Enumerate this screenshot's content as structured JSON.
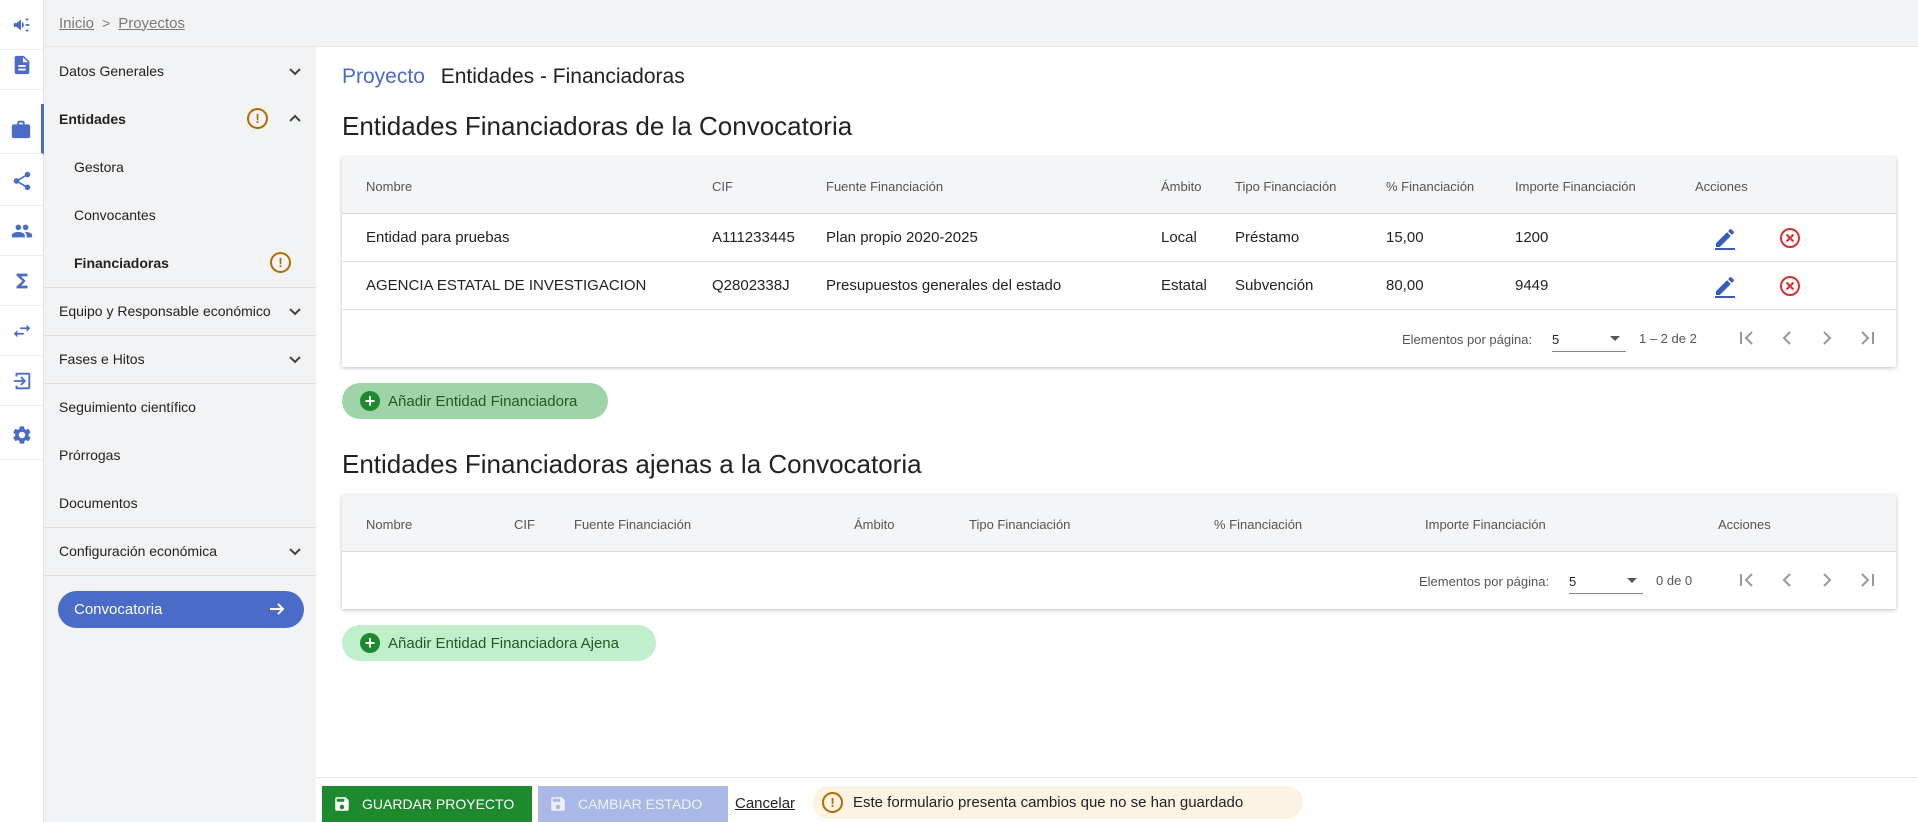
{
  "breadcrumb": {
    "home": "Inicio",
    "separator": ">",
    "current": "Proyectos"
  },
  "rail": [
    "megaphone-icon",
    "document-icon",
    "briefcase-icon",
    "share-icon",
    "people-icon",
    "sigma-icon",
    "swap-icon",
    "logout-icon",
    "settings-icon"
  ],
  "sidebar": {
    "items": [
      {
        "label": "Datos Generales",
        "chevron": "down"
      },
      {
        "label": "Entidades",
        "chevron": "up",
        "warning": "!"
      },
      {
        "label": "Gestora"
      },
      {
        "label": "Convocantes"
      },
      {
        "label": "Financiadoras",
        "warning": "!"
      },
      {
        "label": "Equipo y Responsable económico",
        "chevron": "down"
      },
      {
        "label": "Fases e Hitos",
        "chevron": "down"
      },
      {
        "label": "Seguimiento científico"
      },
      {
        "label": "Prórrogas"
      },
      {
        "label": "Documentos"
      },
      {
        "label": "Configuración económica",
        "chevron": "down"
      }
    ],
    "convocatoria_button": "Convocatoria",
    "accent_color": "#4a6bc7"
  },
  "page": {
    "prefix": "Proyecto",
    "title": "Entidades - Financiadoras"
  },
  "section1": {
    "title": "Entidades Financiadoras de la Convocatoria",
    "columns": [
      "Nombre",
      "CIF",
      "Fuente Financiación",
      "Ámbito",
      "Tipo Financiación",
      "% Financiación",
      "Importe Financiación",
      "Acciones"
    ],
    "rows": [
      [
        "Entidad para pruebas",
        "A111233445",
        "Plan propio 2020-2025",
        "Local",
        "Préstamo",
        "15,00",
        "1200"
      ],
      [
        "AGENCIA ESTATAL DE INVESTIGACION",
        "Q2802338J",
        "Presupuestos generales del estado",
        "Estatal",
        "Subvención",
        "80,00",
        "9449"
      ]
    ],
    "pager": {
      "label": "Elementos por página:",
      "page_size": "5",
      "range": "1 – 2 de 2"
    },
    "add_button": "Añadir Entidad Financiadora",
    "add_button_color": "#9fd4a9"
  },
  "section2": {
    "title": "Entidades Financiadoras ajenas a la Convocatoria",
    "columns": [
      "Nombre",
      "CIF",
      "Fuente Financiación",
      "Ámbito",
      "Tipo Financiación",
      "% Financiación",
      "Importe Financiación",
      "Acciones"
    ],
    "pager": {
      "label": "Elementos por página:",
      "page_size": "5",
      "range": "0 de 0"
    },
    "add_button": "Añadir Entidad Financiadora Ajena",
    "add_button_color": "#c2efcb"
  },
  "footer": {
    "save": "GUARDAR PROYECTO",
    "change_state": "CAMBIAR ESTADO",
    "cancel": "Cancelar",
    "unsaved_message": "Este formulario presenta cambios que no se han guardado",
    "save_color": "#1c8a2d",
    "warning_color": "#b36b00"
  },
  "colors": {
    "edit_icon": "#3b5bbf",
    "delete_icon": "#d93030"
  }
}
